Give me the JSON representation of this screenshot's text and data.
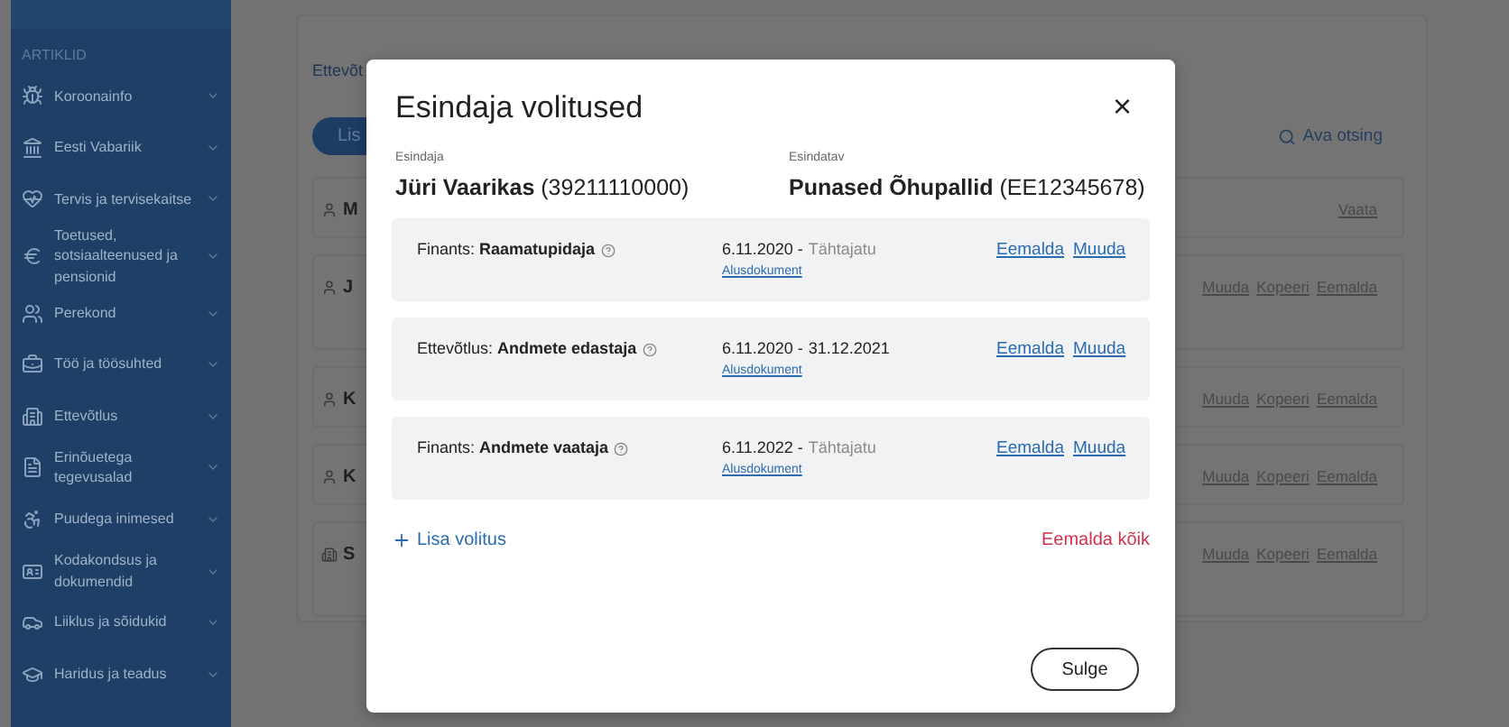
{
  "sidebar": {
    "section_label": "ARTIKLID",
    "items": [
      {
        "label": "Koroonainfo"
      },
      {
        "label": "Eesti Vabariik"
      },
      {
        "label": "Tervis ja tervisekaitse"
      },
      {
        "label": "Toetused, sotsiaalteenused ja pensionid"
      },
      {
        "label": "Perekond"
      },
      {
        "label": "Töö ja töösuhted"
      },
      {
        "label": "Ettevõtlus"
      },
      {
        "label": "Erinõuetega tegevusalad"
      },
      {
        "label": "Puudega inimesed"
      },
      {
        "label": "Kodakondsus ja dokumendid"
      },
      {
        "label": "Liiklus ja sõidukid"
      },
      {
        "label": "Haridus ja teadus"
      }
    ]
  },
  "background": {
    "tab_label": "Ettevõt",
    "add_button": "Lis",
    "search_link": "Ava otsing",
    "rows": [
      {
        "kind": "person",
        "title": "M",
        "actions": [
          "Vaata"
        ]
      },
      {
        "kind": "person",
        "title": "J",
        "actions": [
          "Muuda",
          "Kopeeri",
          "Eemalda"
        ]
      },
      {
        "kind": "person",
        "title": "K",
        "actions": [
          "Muuda",
          "Kopeeri",
          "Eemalda"
        ]
      },
      {
        "kind": "person",
        "title": "K",
        "actions": [
          "Muuda",
          "Kopeeri",
          "Eemalda"
        ]
      },
      {
        "kind": "company",
        "title": "S",
        "actions": [
          "Muuda",
          "Kopeeri",
          "Eemalda"
        ]
      }
    ]
  },
  "modal": {
    "title": "Esindaja volitused",
    "close_label": "×",
    "representative": {
      "label": "Esindaja",
      "name": "Jüri Vaarikas",
      "code": "(39211110000)"
    },
    "represented": {
      "label": "Esindatav",
      "name": "Punased Õhupallid",
      "code": "(EE12345678)"
    },
    "authorizations": [
      {
        "area": "Finants:",
        "role": "Raamatupidaja",
        "start": "6.11.2020 -",
        "end": "Tähtajatu",
        "open_ended": true,
        "document": "Alusdokument",
        "actions": [
          "Eemalda",
          "Muuda"
        ]
      },
      {
        "area": "Ettevõtlus:",
        "role": "Andmete edastaja",
        "start": "6.11.2020 -",
        "end": "31.12.2021",
        "open_ended": false,
        "document": "Alusdokument",
        "actions": [
          "Eemalda",
          "Muuda"
        ]
      },
      {
        "area": "Finants:",
        "role": "Andmete vaataja",
        "start": "6.11.2022 -",
        "end": "Tähtajatu",
        "open_ended": true,
        "document": "Alusdokument",
        "actions": [
          "Eemalda",
          "Muuda"
        ]
      }
    ],
    "add_link": "Lisa volitus",
    "remove_all_link": "Eemalda kõik",
    "close_button": "Sulge"
  }
}
